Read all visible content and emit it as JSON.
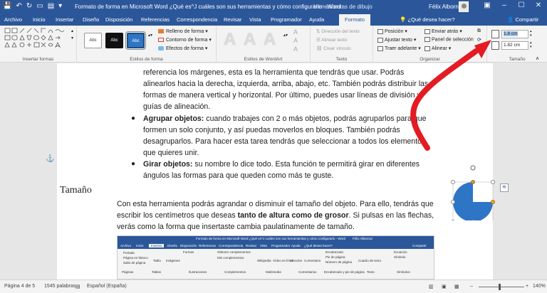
{
  "titlebar": {
    "doc_title": "Formato de forma en Microsoft Word ¿Qué es^J cuáles son sus herramientas y cómo configurarlo - Word",
    "context_tab": "Herramientas de dibujo",
    "user": "Félix Albornoz",
    "min": "–",
    "max": "☐",
    "close": "✕"
  },
  "tabs": [
    "Archivo",
    "Inicio",
    "Insertar",
    "Diseño",
    "Disposición",
    "Referencias",
    "Correspondencia",
    "Revisar",
    "Vista",
    "Programador",
    "Ayuda",
    "Formato"
  ],
  "tellme": "¿Qué desea hacer?",
  "share": "Compartir",
  "ribbon": {
    "groups": {
      "insert_shapes": "Insertar formas",
      "shape_styles": "Estilos de forma",
      "wordart": "Estilos de WordArt",
      "text": "Texto",
      "arrange": "Organizar",
      "size": "Tamaño"
    },
    "style_box_label": "Abc",
    "fill": "Relleno de forma",
    "outline": "Contorno de forma",
    "effects": "Efectos de forma",
    "text_direction": "Dirección del texto",
    "align_text": "Alinear texto",
    "create_link": "Crear vínculo",
    "position": "Posición",
    "wrap_text": "Ajustar texto",
    "bring_forward": "Traer adelante",
    "send_backward": "Enviar atrás",
    "selection_pane": "Panel de selección",
    "align": "Alinear",
    "height": "1.8 cm",
    "width": "1.82 cm"
  },
  "doc": {
    "line1": "referencia los márgenes, esta es la herramienta que tendrás que usar. Podrás",
    "line2": "alinearlos hacia la derecha, izquierda, arriba, abajo, etc. También podrás distribuir las",
    "line3": "formas de manera vertical y horizontal. Por último, puedes usar líneas de división y",
    "line4": "guías de alineación.",
    "b1_bold": "Agrupar objetos:",
    "b1_rest": " cuando trabajes con 2 o más objetos, podrás agruparlos para que",
    "b1_l2": "formen un solo conjunto, y así puedas moverlos en bloques. También podrás",
    "b1_l3": "desagruparlos. Para hacer esta tarea tendrás que seleccionar a todos los elementos",
    "b1_l4": "que quieres unir.",
    "b2_bold": "Girar objetos:",
    "b2_rest": " su nombre lo dice todo. Esta función te permitirá girar en diferentes",
    "b2_l2": "ángulos las formas para que queden como más te guste.",
    "heading": "Tamaño",
    "p1": "Con esta herramienta podrás agrandar o disminuir el tamaño del objeto. Para ello, tendrás que",
    "p2_a": "escribir los centímetros que deseas ",
    "p2_bold": "tanto de altura como de grosor",
    "p2_b": ". Si pulsas en las flechas,",
    "p3": "verás como la forma que insertaste cambia paulatinamente de tamaño."
  },
  "embedded": {
    "title": "Formato de forma en Microsoft Word ¿Qué es^J cuáles son sus herramientas y cómo configurarlo - Word",
    "user": "Félix Albornoz",
    "tabs": [
      "Archivo",
      "Inicio",
      "Insertar",
      "Diseño",
      "Disposición",
      "Referencias",
      "Correspondencia",
      "Revisar",
      "Vista",
      "Programador",
      "Ayuda",
      "¿Qué desea hacer?"
    ],
    "share": "Compartir",
    "items": [
      "Portada",
      "Página en blanco",
      "Salto de página",
      "Tabla",
      "Imágenes",
      "Formas",
      "Obtener complementos",
      "Mis complementos",
      "Wikipedia",
      "Vídeo en línea",
      "Vínculos",
      "Comentario",
      "Encabezado",
      "Pie de página",
      "Número de página",
      "Cuadro de texto",
      "Ecuación",
      "Símbolo"
    ],
    "groups": [
      "Páginas",
      "Tablas",
      "Ilustraciones",
      "Complementos",
      "Multimedia",
      "Comentarios",
      "Encabezado y pie de página",
      "Texto",
      "Símbolos"
    ]
  },
  "status": {
    "page": "Página 4 de 5",
    "words": "1545 palabras",
    "lang": "Español (España)",
    "zoom": "140%"
  },
  "colors": {
    "word_blue": "#2b579a",
    "shape_blue": "#2e75c6",
    "handle_orange": "#f0a030",
    "arrow_red": "#e31b23"
  }
}
